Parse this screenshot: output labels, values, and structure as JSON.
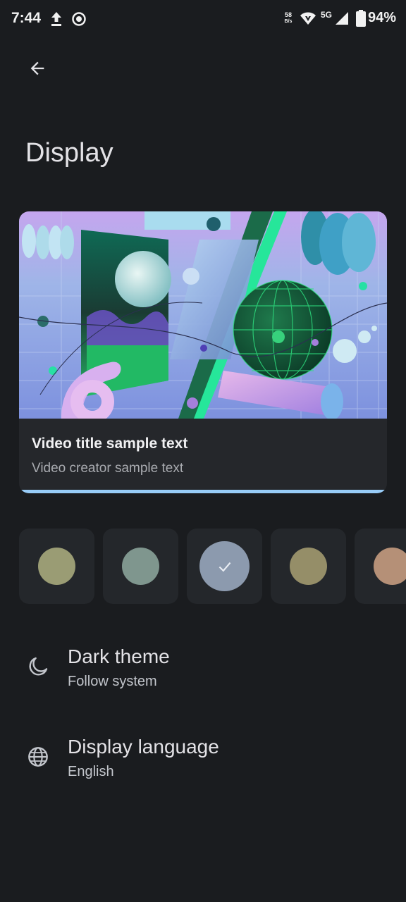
{
  "status_bar": {
    "time": "7:44",
    "net_speed_value": "58",
    "net_speed_unit": "B/s",
    "network_type": "5G",
    "battery": "94%",
    "icons": [
      "upload-icon",
      "screen-record-icon",
      "wifi-icon",
      "cell-signal-icon",
      "battery-icon"
    ]
  },
  "header": {
    "back_icon": "arrow-back-icon",
    "title": "Display"
  },
  "preview": {
    "video_title": "Video title sample text",
    "video_creator": "Video creator sample text",
    "progress": 1.0
  },
  "color_swatches": {
    "colors": [
      "#9a9c74",
      "#7f968e",
      "#8c9aae",
      "#958e68",
      "#b59077"
    ],
    "selected_index": 2,
    "check_icon": "check-icon"
  },
  "settings": {
    "dark_theme": {
      "title": "Dark theme",
      "summary": "Follow system",
      "icon": "moon-icon"
    },
    "display_language": {
      "title": "Display language",
      "summary": "English",
      "icon": "globe-icon"
    }
  },
  "colors": {
    "background": "#1a1c1f",
    "card": "#25272b",
    "accent": "#98ccf7"
  }
}
